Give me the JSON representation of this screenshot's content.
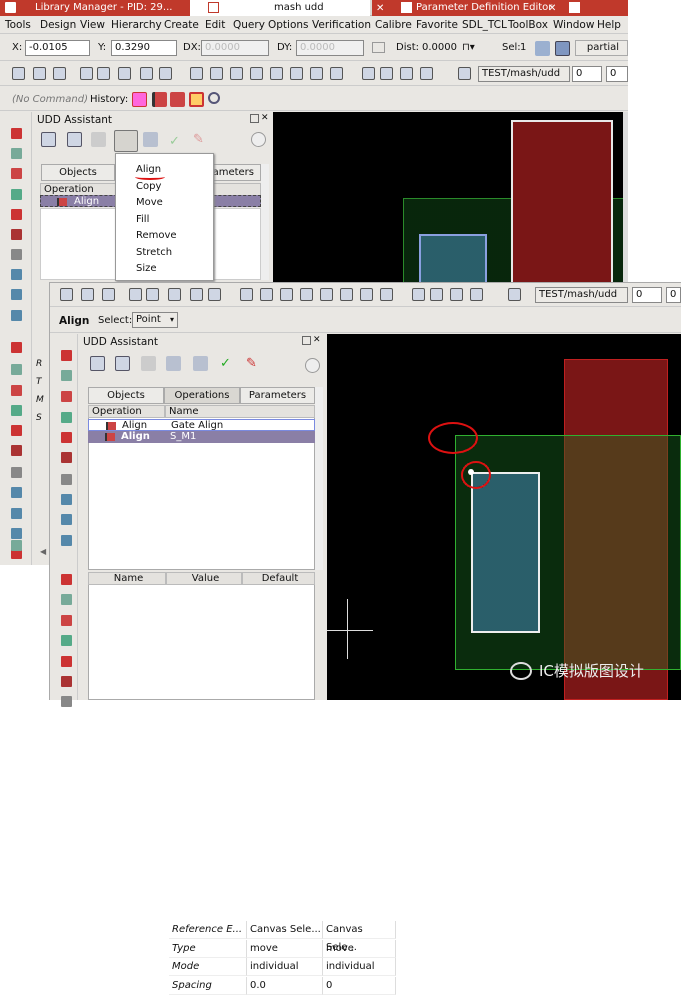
{
  "tabs": [
    {
      "label": "Library Manager - PID: 29..."
    },
    {
      "label": "mash udd"
    },
    {
      "label": "Parameter Definition Editor"
    }
  ],
  "menubar": [
    "Tools",
    "Design",
    "View",
    "Hierarchy",
    "Create",
    "Edit",
    "Query",
    "Options",
    "Verification",
    "Calibre",
    "Favorite",
    "SDL_TCL",
    "ToolBox",
    "Window",
    "Help"
  ],
  "coords": {
    "x_label": "X:",
    "x_value": "-0.0105",
    "y_label": "Y:",
    "y_value": "0.3290",
    "dx_label": "DX:",
    "dx_value": "0.0000",
    "dy_label": "DY:",
    "dy_value": "0.0000",
    "dist_label": "Dist:",
    "dist_value": "0.0000",
    "sel_label": "Sel:",
    "sel_value": "1",
    "partial": "partial"
  },
  "cellview": "TEST/mash/udd",
  "spin_a": "0",
  "spin_b": "0",
  "command": {
    "placeholder": "(No Command)",
    "history_label": "History:"
  },
  "back": {
    "panel_title": "UDD Assistant",
    "tabs": [
      "Objects",
      "Operations",
      "Parameters"
    ],
    "col_operation": "Operation",
    "row_label": "Align",
    "menu": [
      "Align",
      "Copy",
      "Move",
      "Fill",
      "Remove",
      "Stretch",
      "Size"
    ],
    "side_letters": [
      "R",
      "T",
      "M",
      "S"
    ]
  },
  "front": {
    "align_label": "Align",
    "select_label": "Select:",
    "select_value": "Point",
    "panel_title": "UDD Assistant",
    "tabs": [
      "Objects",
      "Operations",
      "Parameters"
    ],
    "ops_headers": [
      "Operation",
      "Name"
    ],
    "ops_rows": [
      {
        "op": "Align",
        "name": "Gate Align"
      },
      {
        "op": "Align",
        "name": "S_M1"
      }
    ],
    "param_headers": [
      "Name",
      "Value",
      "Default"
    ],
    "param_rows": [
      {
        "name": "Reference E...",
        "value": "Canvas Sele...",
        "default": "Canvas Sele..."
      },
      {
        "name": "Type",
        "value": "move",
        "default": "move"
      },
      {
        "name": "Mode",
        "value": "individual",
        "default": "individual"
      },
      {
        "name": "Spacing",
        "value": "0.0",
        "default": "0"
      }
    ]
  },
  "watermark": "IC模拟版图设计",
  "colors": {
    "accent_tab": "#c0392b",
    "selection": "#8a7fa6",
    "canvas": "#000000",
    "red_layer": "#b02020",
    "green_layer": "#20a030",
    "annot": "#dd1111"
  }
}
